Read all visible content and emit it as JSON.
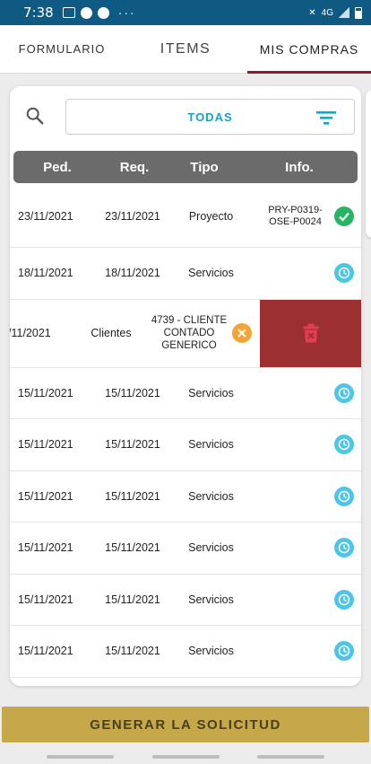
{
  "status_bar": {
    "time": "7:38",
    "dots": "···",
    "network": "4G"
  },
  "tabs": [
    {
      "label": "FORMULARIO",
      "active": false
    },
    {
      "label": "ITEMS",
      "active": false
    },
    {
      "label": "MIS COMPRAS",
      "active": true
    }
  ],
  "filter": {
    "selected": "TODAS"
  },
  "table": {
    "headers": [
      "Ped.",
      "Req.",
      "Tipo",
      "Info."
    ],
    "first_row": {
      "ped": "23/11/2021",
      "req": "23/11/2021",
      "tipo": "Proyecto",
      "info": "PRY-P0319-OSE-P0024",
      "status": "completed"
    },
    "second_row": {
      "ped": "18/11/2021",
      "req": "18/11/2021",
      "tipo": "Servicios",
      "info": "",
      "status": "pending"
    },
    "swiped_row": {
      "date": "/11/2021",
      "tipo": "Clientes",
      "info": "4739 - CLIENTE CONTADO GENERICO",
      "status": "cancelled"
    },
    "rows": [
      {
        "ped": "15/11/2021",
        "req": "15/11/2021",
        "tipo": "Servicios",
        "status": "pending"
      },
      {
        "ped": "15/11/2021",
        "req": "15/11/2021",
        "tipo": "Servicios",
        "status": "pending"
      },
      {
        "ped": "15/11/2021",
        "req": "15/11/2021",
        "tipo": "Servicios",
        "status": "pending"
      },
      {
        "ped": "15/11/2021",
        "req": "15/11/2021",
        "tipo": "Servicios",
        "status": "pending"
      },
      {
        "ped": "15/11/2021",
        "req": "15/11/2021",
        "tipo": "Servicios",
        "status": "pending"
      },
      {
        "ped": "15/11/2021",
        "req": "15/11/2021",
        "tipo": "Servicios",
        "status": "pending"
      }
    ]
  },
  "actions": {
    "generate_label": "GENERAR LA SOLICITUD"
  },
  "colors": {
    "status_bar": "#0f5a82",
    "tab_indicator": "#8b1a2b",
    "accent": "#1aa3c4",
    "delete": "#9c2f2f",
    "button": "#c5a84a",
    "ok": "#28b463",
    "pending": "#4dc5e8",
    "cancel": "#f4a435"
  }
}
